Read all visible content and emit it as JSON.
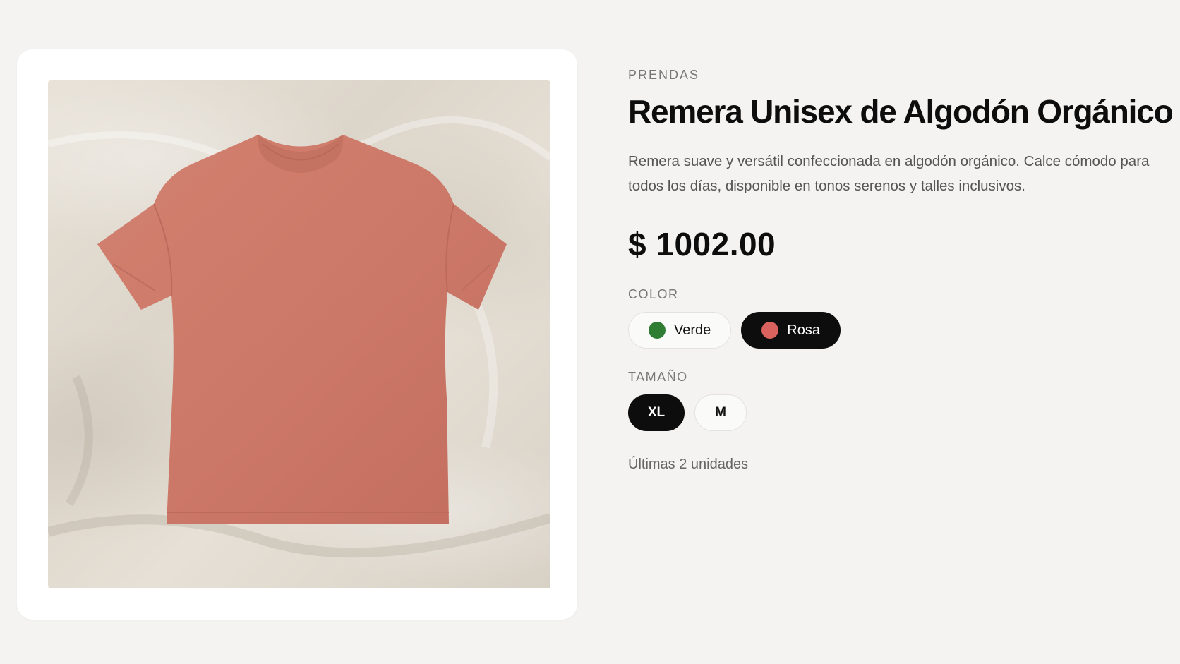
{
  "product": {
    "category": "PRENDAS",
    "title": "Remera Unisex de Algodón Orgánico",
    "description": "Remera suave y versátil confeccionada en algodón orgánico. Calce cómodo para todos los días, disponible en tonos serenos y talles inclusivos.",
    "price": "$ 1002.00",
    "stock_note": "Últimas 2 unidades"
  },
  "color": {
    "label": "COLOR",
    "options": [
      {
        "label": "Verde",
        "swatch": "#2e7d32",
        "selected": false
      },
      {
        "label": "Rosa",
        "swatch": "#d9625e",
        "selected": true
      }
    ]
  },
  "size": {
    "label": "TAMAÑO",
    "options": [
      {
        "label": "XL",
        "selected": true
      },
      {
        "label": "M",
        "selected": false
      }
    ]
  },
  "image": {
    "subject": "tshirt-icon",
    "shirt_color": "#cf7b6e",
    "background_color": "#e4ded4"
  }
}
